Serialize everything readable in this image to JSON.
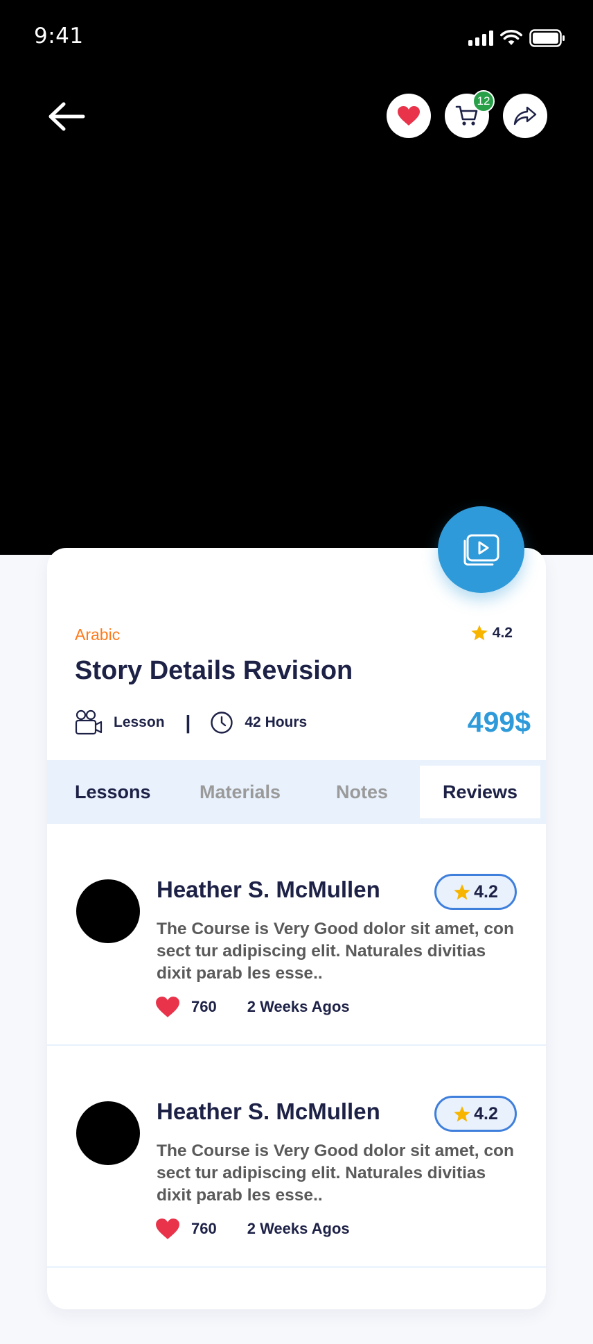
{
  "status_bar": {
    "time": "9:41"
  },
  "header": {
    "cart_count": "12"
  },
  "course": {
    "category": "Arabic",
    "rating": "4.2",
    "title": "Story Details Revision",
    "type_label": "Lesson",
    "separator": "|",
    "duration": "42 Hours",
    "price": "499$"
  },
  "tabs": [
    {
      "label": "Lessons"
    },
    {
      "label": "Materials"
    },
    {
      "label": "Notes"
    },
    {
      "label": "Reviews"
    }
  ],
  "selected_tab": "Reviews",
  "reviews": [
    {
      "name": "Heather S. McMullen",
      "rating": "4.2",
      "text": "The Course is Very Good dolor sit amet, con sect tur adipiscing elit. Naturales divitias dixit parab les esse..",
      "likes": "760",
      "time": "2 Weeks Agos"
    },
    {
      "name": "Heather S. McMullen",
      "rating": "4.2",
      "text": "The Course is Very Good dolor sit amet, con sect tur adipiscing elit. Naturales divitias dixit parab les esse..",
      "likes": "760",
      "time": "2 Weeks Agos"
    }
  ],
  "colors": {
    "accent_blue": "#2e9ad9",
    "category_orange": "#ff7a1a",
    "heart_red": "#e8334a",
    "star_yellow": "#f7b500",
    "badge_green": "#27a048",
    "navy_text": "#1d2146"
  }
}
